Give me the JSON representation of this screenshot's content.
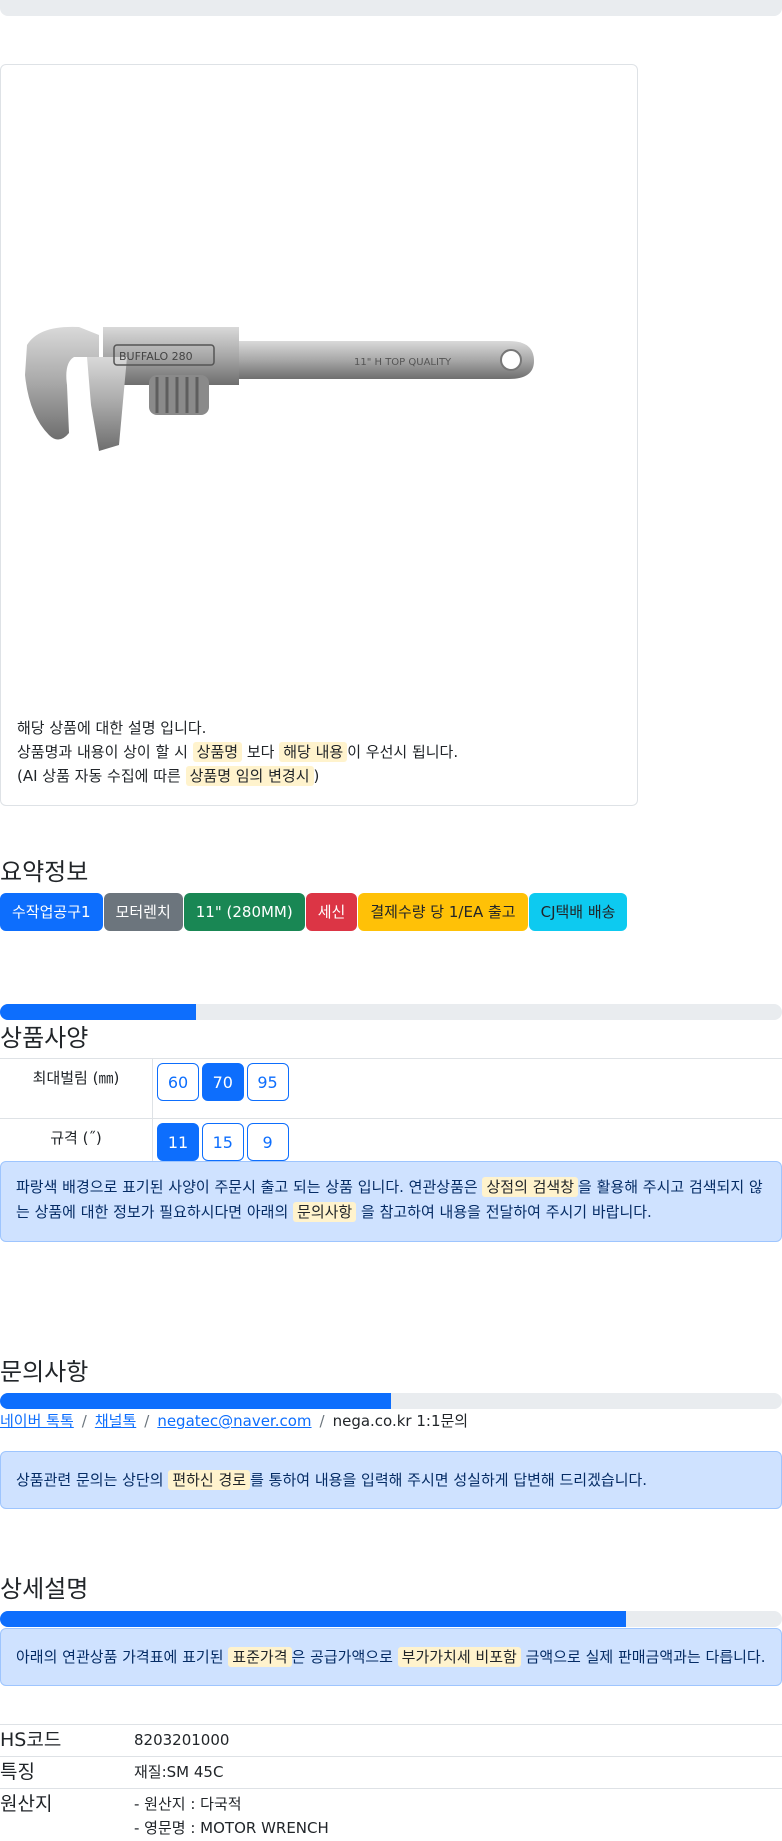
{
  "product_card": {
    "image_icon": "wrench-icon",
    "image_text_brand": "BUFFALO 280",
    "image_text_size": "11\"  H  TOP  QUALITY",
    "notice_line1": "해당 상품에 대한 설명 입니다.",
    "notice_line2_a": "상품명과 내용이 상이 할 시",
    "notice_line2_mark1": "상품명",
    "notice_line2_b": "보다",
    "notice_line2_mark2": "해당 내용",
    "notice_line2_c": "이 우선시 됩니다.",
    "notice_line3_a": "(AI 상품 자동 수집에 따른",
    "notice_line3_mark": "상품명 임의 변경시",
    "notice_line3_b": ")"
  },
  "summary": {
    "title": "요약정보",
    "badges": [
      {
        "label": "수작업공구1",
        "color": "#0d6efd"
      },
      {
        "label": "모터렌치",
        "color": "#6c757d"
      },
      {
        "label": "11\" (280MM)",
        "color": "#198754"
      },
      {
        "label": "세신",
        "color": "#dc3545"
      },
      {
        "label": "결제수량 당 1/EA 출고",
        "color": "#ffc107"
      },
      {
        "label": "CJ택배 배송",
        "color": "#0dcaf0"
      }
    ]
  },
  "spec": {
    "title": "상품사양",
    "progress": 0.25,
    "rows": [
      {
        "label": "최대벌림 (㎜)",
        "options": [
          "60",
          "70",
          "95"
        ],
        "active": "70"
      },
      {
        "label": "규격 (˝)",
        "options": [
          "11",
          "15",
          "9"
        ],
        "active": "11"
      }
    ],
    "alert_a": "파랑색 배경으로 표기된 사양이 주문시 출고 되는 상품 입니다. 연관상품은",
    "alert_mark1": "상점의 검색창",
    "alert_b": "을 활용해 주시고 검색되지 않는 상품에 대한 정보가 필요하시다면 아래의",
    "alert_mark2": "문의사항",
    "alert_c": "을 참고하여 내용을 전달하여 주시기 바랍니다."
  },
  "inquiry": {
    "title": "문의사항",
    "progress": 0.5,
    "links": [
      "네이버 톡톡",
      "채널톡",
      "negatec@naver.com"
    ],
    "plain": "nega.co.kr 1:1문의",
    "separator": "/",
    "alert_a": "상품관련 문의는 상단의",
    "alert_mark": "편하신 경로",
    "alert_b": "를 통하여 내용을 입력해 주시면 성실하게 답변해 드리겠습니다."
  },
  "detail": {
    "title": "상세설명",
    "progress": 0.8,
    "alert_a": "아래의 연관상품 가격표에 표기된",
    "alert_mark1": "표준가격",
    "alert_b": "은 공급가액으로",
    "alert_mark2": "부가가치세 비포함",
    "alert_c": "금액으로 실제 판매금액과는 다릅니다.",
    "info": [
      {
        "key": "HS코드",
        "values": [
          "8203201000"
        ]
      },
      {
        "key": "특징",
        "values": [
          "재질:SM 45C"
        ]
      },
      {
        "key": "원산지",
        "values": [
          "- 원산지 : 다국적",
          "- 영문명 : MOTOR WRENCH"
        ]
      }
    ]
  }
}
